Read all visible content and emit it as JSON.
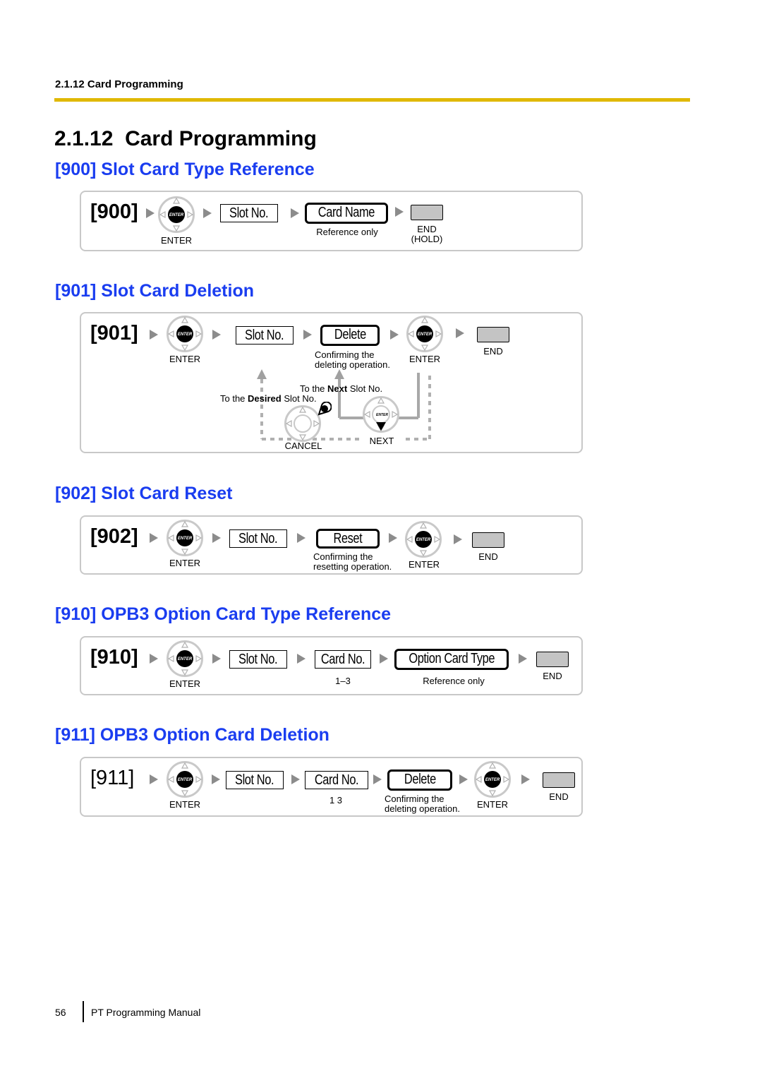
{
  "header": {
    "running_head": "2.1.12 Card Programming",
    "accent_color": "#e0b800"
  },
  "page_title": "2.1.12  Card Programming",
  "section_color": "#1a3df0",
  "labels": {
    "enter": "ENTER",
    "enter_key_glyph": "ENTER",
    "end": "END",
    "end_hold": "(HOLD)",
    "slot_no": "Slot No.",
    "card_no": "Card No.",
    "reference_only": "Reference only",
    "confirm_line1": "Confirming the",
    "confirm_delete_line2": "deleting operation.",
    "confirm_reset_line2": "resetting operation.",
    "cancel": "CANCEL",
    "next": "NEXT"
  },
  "sections": [
    {
      "title": "[900] Slot Card Type Reference",
      "code": "[900]",
      "steps": [
        "enter-key",
        "Slot No.",
        "Card Name",
        "end-key"
      ],
      "card_name": "Card Name"
    },
    {
      "title": "[901] Slot Card Deletion",
      "code": "[901]",
      "steps": [
        "enter-key",
        "Slot No.",
        "Delete",
        "enter-key",
        "end-key"
      ],
      "action": "Delete",
      "next_text_pre": "To the ",
      "next_text_bold": "Next",
      "next_text_post": " Slot No.",
      "desired_text_pre": "To the ",
      "desired_text_bold": "Desired",
      "desired_text_post": " Slot No."
    },
    {
      "title": "[902] Slot Card Reset",
      "code": "[902]",
      "steps": [
        "enter-key",
        "Slot No.",
        "Reset",
        "enter-key",
        "end-key"
      ],
      "action": "Reset"
    },
    {
      "title": "[910] OPB3 Option Card Type Reference",
      "code": "[910]",
      "steps": [
        "enter-key",
        "Slot No.",
        "Card No.",
        "Option Card Type",
        "end-key"
      ],
      "card_range": "1–3",
      "action": "Option Card Type"
    },
    {
      "title": "[911] OPB3 Option Card Deletion",
      "code": "[911]",
      "steps": [
        "enter-key",
        "Slot No.",
        "Card No.",
        "Delete",
        "enter-key",
        "end-key"
      ],
      "card_range": "1 3",
      "action": "Delete"
    }
  ],
  "footer": {
    "page_number": "56",
    "manual_title": "PT Programming Manual"
  }
}
